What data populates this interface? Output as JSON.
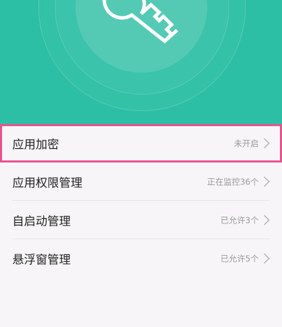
{
  "colors": {
    "hero_bg": "#2dbfa6",
    "page_bg": "#f7f5f7",
    "highlight": "#e8528e"
  },
  "hero": {
    "icon": "key-icon"
  },
  "settings": {
    "items": [
      {
        "label": "应用加密",
        "status": "未开启",
        "icon": "chevron-right-icon"
      },
      {
        "label": "应用权限管理",
        "status": "正在监控36个",
        "icon": "chevron-right-icon"
      },
      {
        "label": "自启动管理",
        "status": "已允许3个",
        "icon": "chevron-right-icon"
      },
      {
        "label": "悬浮窗管理",
        "status": "已允许5个",
        "icon": "chevron-right-icon"
      }
    ]
  }
}
